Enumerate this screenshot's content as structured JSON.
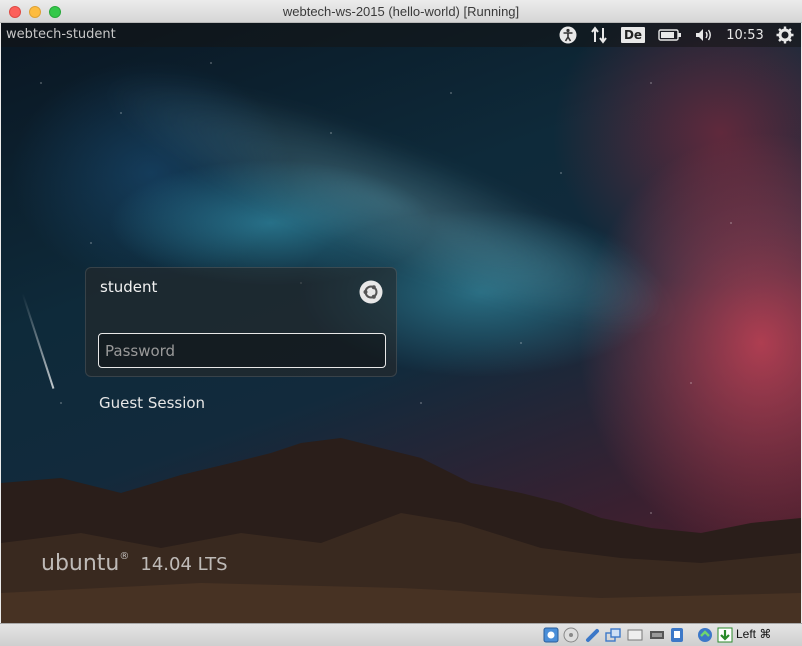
{
  "window": {
    "title": "webtech-ws-2015 (hello-world) [Running]"
  },
  "panel": {
    "hostname": "webtech-student",
    "keyboard_layout": "De",
    "clock": "10:53",
    "indicators": [
      "accessibility-icon",
      "network-icon",
      "keyboard-layout",
      "battery-icon",
      "volume-icon",
      "clock",
      "gear-icon"
    ]
  },
  "greeter": {
    "user": "student",
    "password_placeholder": "Password",
    "guest_label": "Guest Session",
    "session_icon": "ubuntu-session-icon"
  },
  "branding": {
    "name": "ubuntu",
    "version": "14.04 LTS"
  },
  "statusbar": {
    "host_key_label": "Left ⌘",
    "icons": [
      "hard-disk-icon",
      "optical-drive-icon",
      "usb-icon",
      "shared-folders-icon",
      "display-icon",
      "video-capture-icon",
      "usb-device-icon",
      "network-adapter-icon",
      "mouse-integration-icon",
      "arrow-down-icon"
    ]
  }
}
